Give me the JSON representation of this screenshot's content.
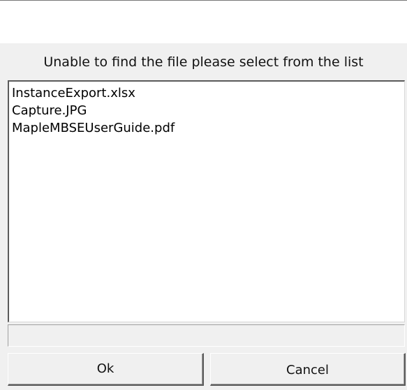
{
  "dialog": {
    "message": "Unable to find the file please select from the list",
    "files": [
      "InstanceExport.xlsx",
      "Capture.JPG",
      "MapleMBSEUserGuide.pdf"
    ],
    "status_text": "",
    "ok_label": "Ok",
    "cancel_label": "Cancel"
  }
}
